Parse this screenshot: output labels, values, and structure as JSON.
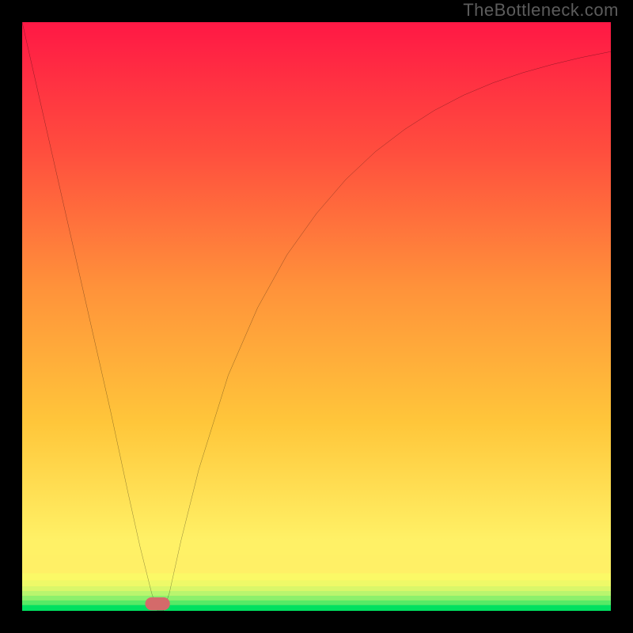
{
  "watermark": "TheBottleneck.com",
  "chart_data": {
    "type": "line",
    "title": "",
    "xlabel": "",
    "ylabel": "",
    "xlim": [
      0,
      100
    ],
    "ylim": [
      0,
      100
    ],
    "background_gradient": {
      "top": "#ff1845",
      "mid": "#ffbf00",
      "bottom": "#00e060"
    },
    "series": [
      {
        "name": "bottleneck-curve",
        "color": "#000000",
        "x": [
          0,
          5,
          10,
          15,
          18,
          20,
          21,
          22,
          23,
          24,
          25,
          27,
          30,
          35,
          40,
          45,
          50,
          55,
          60,
          65,
          70,
          75,
          80,
          85,
          90,
          95,
          100
        ],
        "values": [
          100,
          78,
          56,
          34,
          20,
          11,
          7,
          3,
          0,
          0,
          3,
          12,
          24,
          40,
          51.5,
          60.5,
          67.5,
          73.3,
          78,
          81.8,
          85,
          87.6,
          89.7,
          91.4,
          92.8,
          94,
          95
        ]
      }
    ],
    "marker": {
      "name": "target-marker",
      "x": 23,
      "y": 1.2,
      "width": 4.2,
      "height": 2.2,
      "rx": 1.1,
      "fill": "#d46a6a"
    },
    "bottom_bands": [
      {
        "from_y": 0,
        "to_y": 1.0,
        "color": "#00e060"
      },
      {
        "from_y": 1.0,
        "to_y": 1.8,
        "color": "#57ea66"
      },
      {
        "from_y": 1.8,
        "to_y": 2.6,
        "color": "#8cf06c"
      },
      {
        "from_y": 2.6,
        "to_y": 3.4,
        "color": "#b9f56e"
      },
      {
        "from_y": 3.4,
        "to_y": 4.2,
        "color": "#d9f76a"
      },
      {
        "from_y": 4.2,
        "to_y": 5.2,
        "color": "#eef968"
      },
      {
        "from_y": 5.2,
        "to_y": 6.4,
        "color": "#fbf966"
      },
      {
        "from_y": 6.4,
        "to_y": 9.5,
        "color": "#fff066"
      }
    ]
  }
}
